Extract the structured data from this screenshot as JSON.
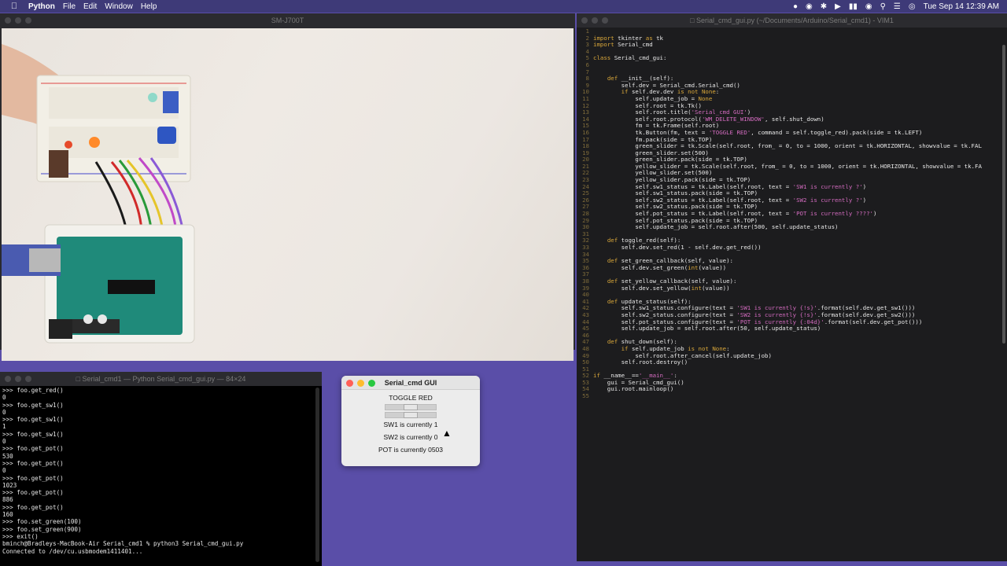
{
  "menubar": {
    "app_name": "Python",
    "items": [
      "File",
      "Edit",
      "Window",
      "Help"
    ],
    "clock": "Tue Sep 14  12:39 AM"
  },
  "camera_window": {
    "title": "SM-J700T"
  },
  "vim_window": {
    "title": "Serial_cmd_gui.py (~/Documents/Arduino/Serial_cmd1) - VIM1",
    "lines": [
      [
        [
          "",
          ""
        ]
      ],
      [
        [
          "k",
          "import"
        ],
        [
          "",
          " tkinter "
        ],
        [
          "k",
          "as"
        ],
        [
          "",
          " tk"
        ]
      ],
      [
        [
          "k",
          "import"
        ],
        [
          "",
          " Serial_cmd"
        ]
      ],
      [
        [
          "",
          ""
        ]
      ],
      [
        [
          "k",
          "class"
        ],
        [
          "",
          " Serial_cmd_gui:"
        ]
      ],
      [
        [
          "",
          ""
        ]
      ],
      [
        [
          "",
          ""
        ]
      ],
      [
        [
          "",
          "    "
        ],
        [
          "k",
          "def"
        ],
        [
          "",
          " __init__(self):"
        ]
      ],
      [
        [
          "",
          "        self.dev = Serial_cmd.Serial_cmd()"
        ]
      ],
      [
        [
          "",
          "        "
        ],
        [
          "k",
          "if"
        ],
        [
          "",
          " self.dev.dev "
        ],
        [
          "k",
          "is not"
        ],
        [
          "",
          " "
        ],
        [
          "k",
          "None"
        ],
        [
          "",
          ":"
        ]
      ],
      [
        [
          "",
          "            self.update_job = "
        ],
        [
          "k",
          "None"
        ]
      ],
      [
        [
          "",
          "            self.root = tk.Tk()"
        ]
      ],
      [
        [
          "",
          "            self.root.title("
        ],
        [
          "s",
          "'Serial_cmd GUI'"
        ],
        [
          "",
          ")"
        ]
      ],
      [
        [
          "",
          "            self.root.protocol("
        ],
        [
          "s",
          "'WM_DELETE_WINDOW'"
        ],
        [
          "",
          ", self.shut_down)"
        ]
      ],
      [
        [
          "",
          "            fm = tk.Frame(self.root)"
        ]
      ],
      [
        [
          "",
          "            tk.Button(fm, text = "
        ],
        [
          "s",
          "'TOGGLE RED'"
        ],
        [
          "",
          ", command = self.toggle_red).pack(side = tk.LEFT)"
        ]
      ],
      [
        [
          "",
          "            fm.pack(side = tk.TOP)"
        ]
      ],
      [
        [
          "",
          "            green_slider = tk.Scale(self.root, from_ = 0, to = 1000, orient = tk.HORIZONTAL, showvalue = tk.FAL"
        ]
      ],
      [
        [
          "",
          "            green_slider.set(500)"
        ]
      ],
      [
        [
          "",
          "            green_slider.pack(side = tk.TOP)"
        ]
      ],
      [
        [
          "",
          "            yellow_slider = tk.Scale(self.root, from_ = 0, to = 1000, orient = tk.HORIZONTAL, showvalue = tk.FA"
        ]
      ],
      [
        [
          "",
          "            yellow_slider.set(500)"
        ]
      ],
      [
        [
          "",
          "            yellow_slider.pack(side = tk.TOP)"
        ]
      ],
      [
        [
          "",
          "            self.sw1_status = tk.Label(self.root, text = "
        ],
        [
          "s",
          "'SW1 is currently ?'"
        ],
        [
          "",
          ")"
        ]
      ],
      [
        [
          "",
          "            self.sw1_status.pack(side = tk.TOP)"
        ]
      ],
      [
        [
          "",
          "            self.sw2_status = tk.Label(self.root, text = "
        ],
        [
          "s",
          "'SW2 is currently ?'"
        ],
        [
          "",
          ")"
        ]
      ],
      [
        [
          "",
          "            self.sw2_status.pack(side = tk.TOP)"
        ]
      ],
      [
        [
          "",
          "            self.pot_status = tk.Label(self.root, text = "
        ],
        [
          "s",
          "'POT is currently ????'"
        ],
        [
          "",
          ")"
        ]
      ],
      [
        [
          "",
          "            self.pot_status.pack(side = tk.TOP)"
        ]
      ],
      [
        [
          "",
          "            self.update_job = self.root.after(500, self.update_status)"
        ]
      ],
      [
        [
          "",
          ""
        ]
      ],
      [
        [
          "",
          "    "
        ],
        [
          "k",
          "def"
        ],
        [
          "",
          " toggle_red(self):"
        ]
      ],
      [
        [
          "",
          "        self.dev.set_red(1 - self.dev.get_red())"
        ]
      ],
      [
        [
          "",
          ""
        ]
      ],
      [
        [
          "",
          "    "
        ],
        [
          "k",
          "def"
        ],
        [
          "",
          " set_green_callback(self, value):"
        ]
      ],
      [
        [
          "",
          "        self.dev.set_green("
        ],
        [
          "k",
          "int"
        ],
        [
          "",
          "(value))"
        ]
      ],
      [
        [
          "",
          ""
        ]
      ],
      [
        [
          "",
          "    "
        ],
        [
          "k",
          "def"
        ],
        [
          "",
          " set_yellow_callback(self, value):"
        ]
      ],
      [
        [
          "",
          "        self.dev.set_yellow("
        ],
        [
          "k",
          "int"
        ],
        [
          "",
          "(value))"
        ]
      ],
      [
        [
          "",
          ""
        ]
      ],
      [
        [
          "",
          "    "
        ],
        [
          "k",
          "def"
        ],
        [
          "",
          " update_status(self):"
        ]
      ],
      [
        [
          "",
          "        self.sw1_status.configure(text = "
        ],
        [
          "s",
          "'SW1 is currently {!s}'"
        ],
        [
          "",
          ".format(self.dev.get_sw1()))"
        ]
      ],
      [
        [
          "",
          "        self.sw2_status.configure(text = "
        ],
        [
          "s",
          "'SW2 is currently {!s}'"
        ],
        [
          "",
          ".format(self.dev.get_sw2()))"
        ]
      ],
      [
        [
          "",
          "        self.pot_status.configure(text = "
        ],
        [
          "s",
          "'POT is currently {:04d}'"
        ],
        [
          "",
          ".format(self.dev.get_pot()))"
        ]
      ],
      [
        [
          "",
          "        self.update_job = self.root.after(50, self.update_status)"
        ]
      ],
      [
        [
          "",
          ""
        ]
      ],
      [
        [
          "",
          "    "
        ],
        [
          "k",
          "def"
        ],
        [
          "",
          " shut_down(self):"
        ]
      ],
      [
        [
          "",
          "        "
        ],
        [
          "k",
          "if"
        ],
        [
          "",
          " self.update_job "
        ],
        [
          "k",
          "is not"
        ],
        [
          "",
          " "
        ],
        [
          "k",
          "None"
        ],
        [
          "",
          ":"
        ]
      ],
      [
        [
          "",
          "            self.root.after_cancel(self.update_job)"
        ]
      ],
      [
        [
          "",
          "        self.root.destroy()"
        ]
      ],
      [
        [
          "",
          ""
        ]
      ],
      [
        [
          "k",
          "if"
        ],
        [
          "",
          " __name__=="
        ],
        [
          "s",
          "'__main__'"
        ],
        [
          "",
          ":"
        ]
      ],
      [
        [
          "",
          "    gui = Serial_cmd_gui()"
        ]
      ],
      [
        [
          "",
          "    gui.root.mainloop()"
        ]
      ],
      [
        [
          "",
          ""
        ]
      ]
    ]
  },
  "terminal_window": {
    "title": "Serial_cmd1 — Python Serial_cmd_gui.py — 84×24",
    "lines": [
      ">>> foo.get_red()",
      "0",
      ">>> foo.get_sw1()",
      "0",
      ">>> foo.get_sw1()",
      "1",
      ">>> foo.get_sw1()",
      "0",
      ">>> foo.get_pot()",
      "530",
      ">>> foo.get_pot()",
      "0",
      ">>> foo.get_pot()",
      "1023",
      ">>> foo.get_pot()",
      "886",
      ">>> foo.get_pot()",
      "160",
      ">>> foo.set_green(100)",
      ">>> foo.set_green(900)",
      ">>> exit()",
      "bminch@Bradleys-MacBook-Air Serial_cmd1 % python3 Serial_cmd_gui.py",
      "Connected to /dev/cu.usbmodem1411401...",
      ""
    ]
  },
  "tk_window": {
    "title": "Serial_cmd GUI",
    "toggle_label": "TOGGLE RED",
    "green_slider_value": 0.5,
    "yellow_slider_value": 0.5,
    "sw1_label": "SW1 is currently 1",
    "sw2_label": "SW2 is currently 0",
    "pot_label": "POT is currently 0503"
  },
  "colors": {
    "desktop": "#5a4ea8",
    "close": "#ff5f57",
    "minimize": "#febc2e",
    "zoom": "#28c840"
  }
}
